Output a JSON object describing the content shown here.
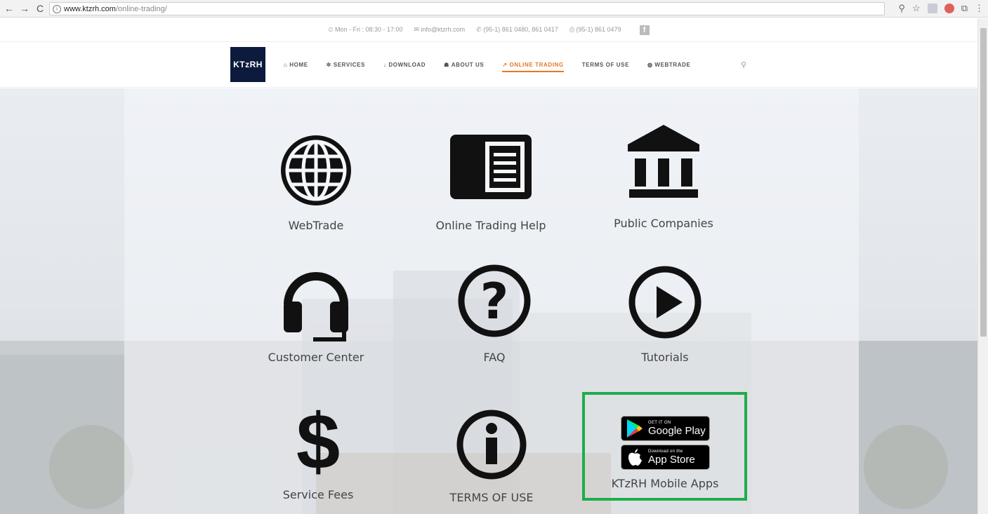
{
  "browser": {
    "url_host": "www.ktzrh.com",
    "url_path": "/online-trading/"
  },
  "topbar": {
    "hours": "Mon - Fri : 08:30 - 17:00",
    "email": "info@ktzrh.com",
    "phone": "(95-1) 861 0480, 861 0417",
    "fax": "(95-1) 861 0479"
  },
  "header": {
    "logo": "KTzRH",
    "menu": [
      {
        "icon": "home-icon",
        "label": "HOME"
      },
      {
        "icon": "gear-icon",
        "label": "SERVICES"
      },
      {
        "icon": "download-icon",
        "label": "DOWNLOAD"
      },
      {
        "icon": "users-icon",
        "label": "ABOUT US"
      },
      {
        "icon": "chart-icon",
        "label": "ONLINE TRADING"
      },
      {
        "icon": "",
        "label": "TERMS OF USE"
      },
      {
        "icon": "globe-icon",
        "label": "WEBTRADE"
      }
    ]
  },
  "tiles": [
    {
      "label": "WebTrade",
      "icon": "globe-icon"
    },
    {
      "label": "Online Trading Help",
      "icon": "document-panel-icon"
    },
    {
      "label": "Public Companies",
      "icon": "bank-icon"
    },
    {
      "label": "Customer Center",
      "icon": "headset-icon"
    },
    {
      "label": "FAQ",
      "icon": "question-icon"
    },
    {
      "label": "Tutorials",
      "icon": "play-icon"
    },
    {
      "label": "Service Fees",
      "icon": "dollar-icon"
    },
    {
      "label": "TERMS OF USE",
      "icon": "info-icon"
    },
    {
      "label": "KTzRH Mobile Apps",
      "icon": "mobile-apps-icon"
    }
  ],
  "badges": {
    "google_small": "GET IT ON",
    "google_big": "Google Play",
    "apple_small": "Download on the",
    "apple_big": "App Store"
  },
  "colors": {
    "accent": "#e87722",
    "logo_bg": "#0c1a3d",
    "highlight": "#1fad4b"
  }
}
